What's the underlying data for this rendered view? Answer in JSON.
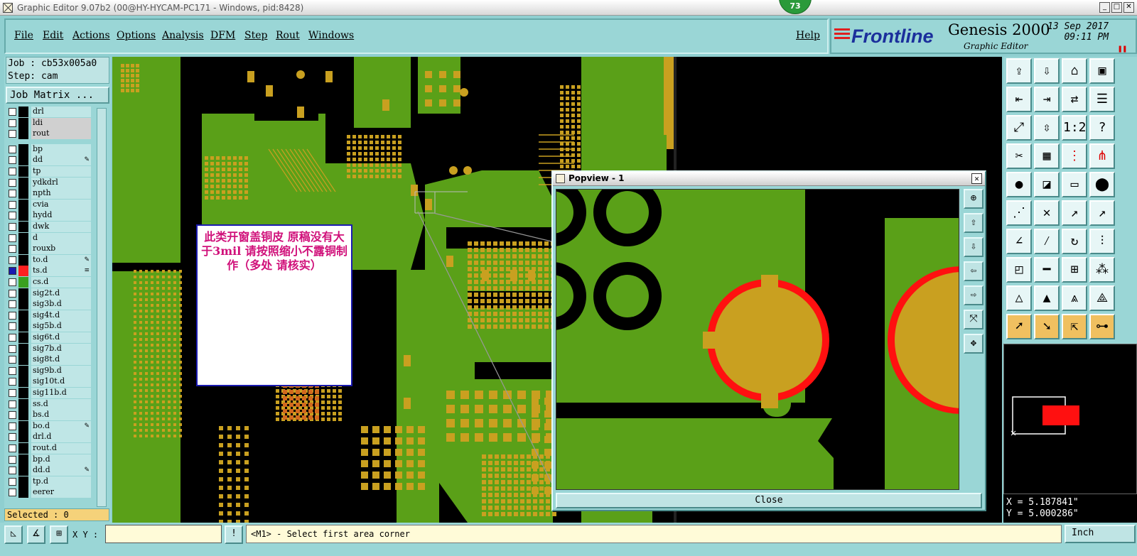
{
  "window": {
    "title": "Graphic Editor 9.07b2 (00@HY-HYCAM-PC171 - Windows, pid:8428)",
    "badge": "73",
    "buttons": [
      "_",
      "□",
      "✕"
    ]
  },
  "menu": {
    "items": [
      "File",
      "Edit",
      "Actions",
      "Options",
      "Analysis",
      "DFM",
      "Step",
      "Rout",
      "Windows"
    ],
    "help": "Help"
  },
  "brand": {
    "logo": "Frontline",
    "product": "Genesis 2000",
    "subtitle": "Graphic Editor",
    "date": "13 Sep 2017",
    "time": "09:11 PM"
  },
  "job": {
    "job_line": "Job : cb53x005a0",
    "step_line": "Step: cam",
    "matrix_button": "Job Matrix ..."
  },
  "layers": [
    {
      "name": "drl",
      "bg": "#bfe6e6"
    },
    {
      "name": "ldi",
      "bg": "#d0d0d0"
    },
    {
      "name": "rout",
      "bg": "#d0d0d0"
    },
    {
      "name": "bp"
    },
    {
      "name": "dd",
      "mark": "✎"
    },
    {
      "name": "tp"
    },
    {
      "name": "ydkdrl"
    },
    {
      "name": "npth"
    },
    {
      "name": "cvia"
    },
    {
      "name": "hydd"
    },
    {
      "name": "dwk"
    },
    {
      "name": "d"
    },
    {
      "name": "rouxb"
    },
    {
      "name": "to.d",
      "mark": "✎"
    },
    {
      "name": "ts.d",
      "mark": "≡",
      "color": "#ff2020",
      "checked": true
    },
    {
      "name": "cs.d",
      "color": "#3aa020"
    },
    {
      "name": "sig2t.d"
    },
    {
      "name": "sig3b.d"
    },
    {
      "name": "sig4t.d"
    },
    {
      "name": "sig5b.d"
    },
    {
      "name": "sig6t.d"
    },
    {
      "name": "sig7b.d"
    },
    {
      "name": "sig8t.d"
    },
    {
      "name": "sig9b.d"
    },
    {
      "name": "sig10t.d"
    },
    {
      "name": "sig11b.d"
    },
    {
      "name": "ss.d"
    },
    {
      "name": "bs.d"
    },
    {
      "name": "bo.d",
      "mark": "✎"
    },
    {
      "name": "drl.d"
    },
    {
      "name": "rout.d"
    },
    {
      "name": "bp.d"
    },
    {
      "name": "dd.d",
      "mark": "✎"
    },
    {
      "name": "tp.d"
    },
    {
      "name": "eerer"
    }
  ],
  "selected": "Selected : 0",
  "note": {
    "text": "此类开窗盖铜皮  原稿没有大于3mil  请按照缩小不露铜制作（多处 请核实）"
  },
  "popview": {
    "title": "Popview - 1",
    "close_button": "Close"
  },
  "coords": {
    "x": "X = 5.187841\"",
    "y": "Y = 5.000286\""
  },
  "bottom": {
    "xy_label": "X Y :",
    "xy_value": "",
    "status": "<M1> - Select first area corner",
    "unit": "Inch"
  },
  "colors": {
    "board_green": "#5aa018",
    "copper": "#c9a020",
    "highlight_red": "#ff1010",
    "panel_cyan": "#9ad6d6"
  }
}
